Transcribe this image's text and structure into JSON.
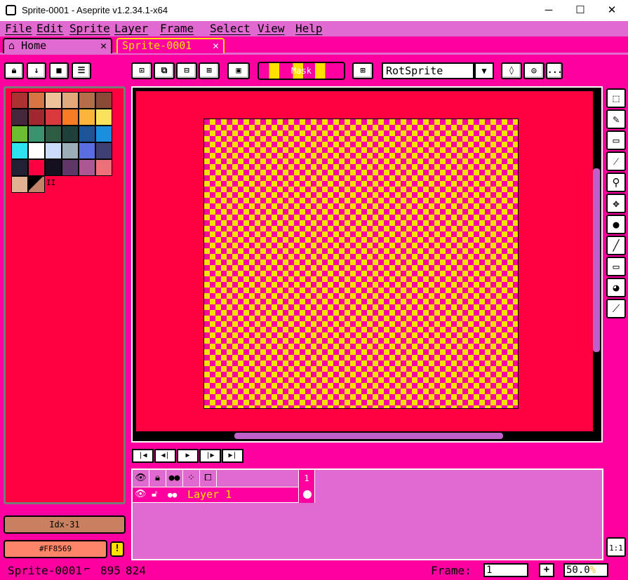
{
  "window": {
    "title": "Sprite-0001 - Aseprite v1.2.34.1-x64",
    "minimize": "─",
    "maximize": "☐",
    "close": "✕"
  },
  "menu": [
    "File",
    "Edit",
    "Sprite",
    "Layer",
    "Frame",
    "Select",
    "View",
    "Help"
  ],
  "tabs": [
    {
      "label": "Home",
      "icon": "home-icon",
      "close": "✕"
    },
    {
      "label": "Sprite-0001",
      "close": "✕"
    }
  ],
  "toolbar": {
    "mask_label": "Mask",
    "rotation_algorithm": "RotSprite",
    "more": "..."
  },
  "palette": {
    "colors": [
      "#ac3232",
      "#d77643",
      "#eec39a",
      "#e2a87e",
      "#b46f4a",
      "#8a4836",
      "#45283c",
      "#a0282e",
      "#d9393c",
      "#f77b23",
      "#fbb53a",
      "#fbe25e",
      "#6abe30",
      "#37946e",
      "#2e5b44",
      "#1f3f3a",
      "#1d5496",
      "#1b8fde",
      "#2ee2f0",
      "#ffffff",
      "#cbdbfc",
      "#9badb7",
      "#5b6ee1",
      "#3f3f74",
      "#222034",
      "#ff0040",
      "#141020",
      "#5e3668",
      "#ab5892",
      "#eb7077",
      "#e0b090",
      "#c08468"
    ],
    "marker": "II"
  },
  "timeline": {
    "layer_name": "Layer 1",
    "frame_number": "1"
  },
  "color_bar": {
    "index_label": "Idx-31",
    "hex_label": "#FF8569",
    "warn": "!"
  },
  "status": {
    "sprite_name": "Sprite-0001",
    "width": "895",
    "height": "824",
    "frame_label": "Frame:",
    "frame_value": "1",
    "plus": "+",
    "zoom": "50.0"
  },
  "colors": {
    "accent": "#ff00a0",
    "panel": "#e06ad0",
    "canvas_bg": "#ff0040",
    "checker_a": "#ffe000",
    "checker_b": "#ff00a0"
  }
}
